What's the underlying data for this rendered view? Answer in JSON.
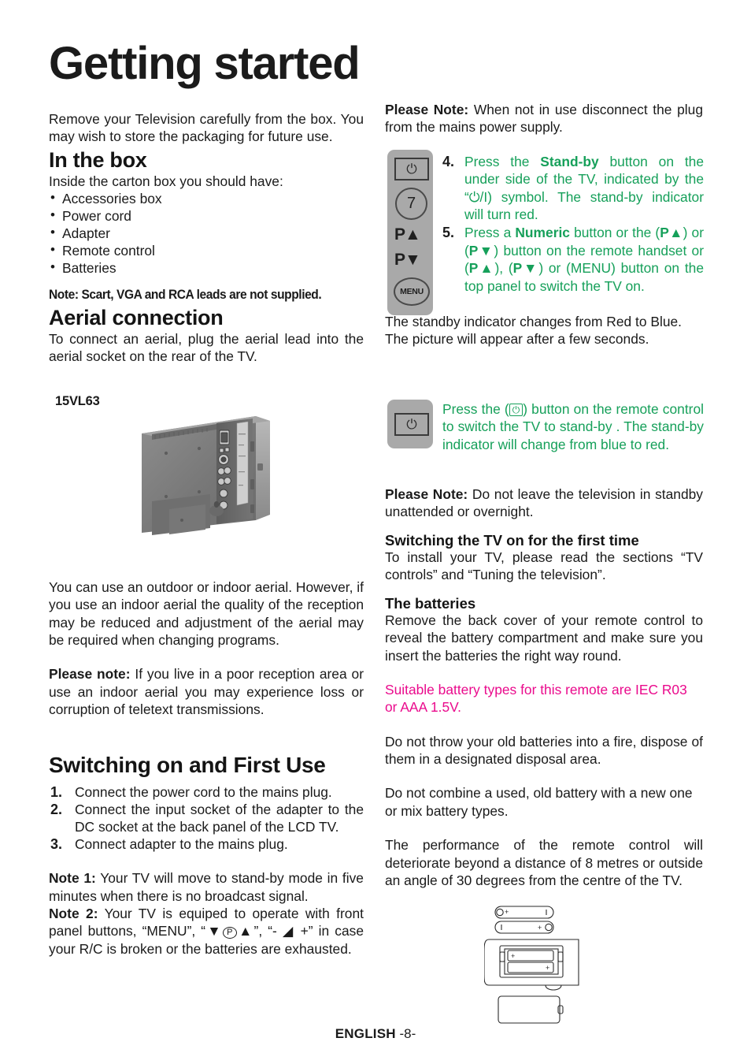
{
  "document": {
    "title": "Getting started",
    "footer_language": "ENGLISH",
    "footer_page": "-8-"
  },
  "colors": {
    "green": "#16a05a",
    "magenta": "#ea0a8c",
    "panel_gray": "#a9a9a9",
    "text": "#1a1a1a"
  },
  "left_column": {
    "intro": "Remove your Television carefully from the box. You may wish to store the packaging for future use.",
    "in_the_box": {
      "heading": "In the box",
      "lead": "Inside the carton box you should have:",
      "items": [
        "Accessories box",
        "Power cord",
        "Adapter",
        "Remote control",
        "Batteries"
      ],
      "note": "Note: Scart, VGA and RCA leads are not supplied."
    },
    "aerial": {
      "heading": "Aerial connection",
      "text": "To connect an aerial, plug the aerial lead into the aerial socket on the rear of the TV."
    },
    "model_label": "15VL63",
    "aerial_followup": "You can use an outdoor or indoor aerial. However, if you use an indoor aerial the quality of the reception may be reduced and adjustment of the aerial may be required when changing programs.",
    "please_note": {
      "label": "Please note:",
      "text": "If you live in a poor reception area or use an indoor aerial you may experience loss or corruption of teletext transmissions."
    },
    "switching_on": {
      "heading": "Switching on and First Use",
      "steps": [
        {
          "n": "1.",
          "text": "Connect the power cord to the mains plug."
        },
        {
          "n": "2.",
          "text": "Connect the input socket of the adapter to the DC socket at the back panel of the LCD TV."
        },
        {
          "n": "3.",
          "text": "Connect adapter to the mains plug."
        }
      ]
    },
    "note1": {
      "label": "Note 1:",
      "text": "Your TV will move to stand-by mode in five minutes when there is no broadcast signal."
    },
    "note2": {
      "label": "Note 2:",
      "text_a": "Your TV is equiped to operate with front panel buttons, “MENU”, “▼",
      "text_p": "P",
      "text_b": "▲”, “- ",
      "text_vol": "◢",
      "text_c": " +”   in case your R/C is broken or the batteries are exhausted."
    }
  },
  "right_column": {
    "please_note_1": {
      "label": "Please Note:",
      "text": "When not in use disconnect the plug from the mains power supply."
    },
    "top_panel": {
      "power_icon": "⏻",
      "channel_number": "7",
      "p_up": "P▲",
      "p_down": "P▼",
      "menu_label": "MENU"
    },
    "steps": [
      {
        "n": "4.",
        "parts": [
          {
            "t": "Press the ",
            "b": false
          },
          {
            "t": "Stand-by",
            "b": true
          },
          {
            "t": " button on the under side of the TV, indicated by the “⏻/I) symbol. The stand-by indicator will turn red.",
            "b": false
          }
        ]
      },
      {
        "n": "5.",
        "parts": [
          {
            "t": "Press a ",
            "b": false
          },
          {
            "t": "Numeric",
            "b": true
          },
          {
            "t": " button or the (",
            "b": false
          },
          {
            "t": "P▲",
            "b": true
          },
          {
            "t": ") or (",
            "b": false
          },
          {
            "t": "P▼",
            "b": true
          },
          {
            "t": ") button on the remote handset or (",
            "b": false
          },
          {
            "t": "P▲",
            "b": true
          },
          {
            "t": "), (",
            "b": false
          },
          {
            "t": "P▼",
            "b": true
          },
          {
            "t": ") or (MENU) button on the top panel to switch the TV on.",
            "b": false
          }
        ]
      }
    ],
    "after_steps": "The standby indicator changes from Red to Blue.\nThe picture will appear after a few seconds.",
    "standby_block": {
      "before": "Press the (",
      "icon": "⏻",
      "after": ") button on the remote control to switch the TV to stand-by . The stand-by indicator will change from blue to red."
    },
    "please_note_2": {
      "label": "Please Note:",
      "text": "Do not leave the television in standby unattended or overnight."
    },
    "first_time": {
      "heading": "Switching the TV on for the first time",
      "text": "To install your TV, please read the sections “TV controls” and “Tuning the television”."
    },
    "batteries": {
      "heading": "The batteries",
      "text": "Remove the back cover of your remote control to reveal the battery compartment and make sure you insert the batteries the right way round.",
      "suitable": "Suitable battery types for this remote are  IEC R03 or AAA 1.5V.",
      "dispose": "Do not throw your old batteries into a fire, dispose of them in a designated disposal area.",
      "mix": "Do not combine a used, old battery with a new one or mix battery types.",
      "range": "The performance of the remote control will deteriorate beyond a distance of 8 metres or outside an angle of 30 degrees from the centre of the TV.",
      "polarity_plus": "+",
      "polarity_minus": "–"
    }
  }
}
